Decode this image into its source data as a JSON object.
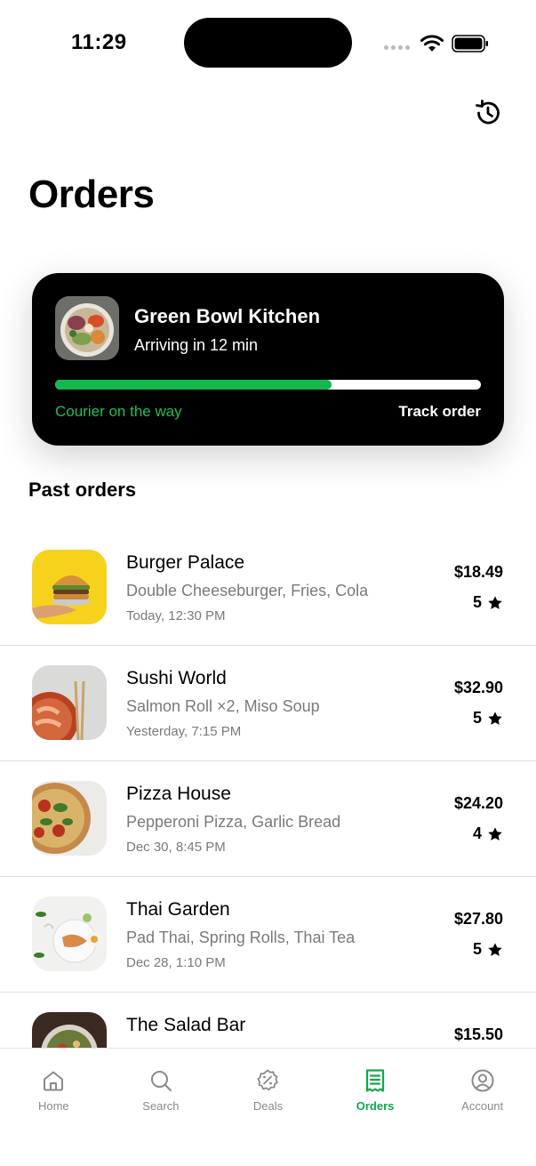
{
  "status_bar": {
    "time": "11:29"
  },
  "header": {
    "title": "Orders",
    "history_icon": "history-icon"
  },
  "active_order": {
    "restaurant": "Green Bowl Kitchen",
    "eta": "Arriving in 12 min",
    "progress": 0.65,
    "status": "Courier on the way",
    "action": "Track order",
    "accent": "#15b84e"
  },
  "past_orders": {
    "title": "Past orders",
    "items": [
      {
        "name": "Burger Palace",
        "items": "Double Cheeseburger, Fries, Cola",
        "date": "Today, 12:30 PM",
        "price": "$18.49",
        "rating": "5"
      },
      {
        "name": "Sushi World",
        "items": "Salmon Roll ×2, Miso Soup",
        "date": "Yesterday, 7:15 PM",
        "price": "$32.90",
        "rating": "5"
      },
      {
        "name": "Pizza House",
        "items": "Pepperoni Pizza, Garlic Bread",
        "date": "Dec 30, 8:45 PM",
        "price": "$24.20",
        "rating": "4"
      },
      {
        "name": "Thai Garden",
        "items": "Pad Thai, Spring Rolls, Thai Tea",
        "date": "Dec 28, 1:10 PM",
        "price": "$27.80",
        "rating": "5"
      },
      {
        "name": "The Salad Bar",
        "items": "",
        "date": "",
        "price": "$15.50",
        "rating": ""
      }
    ]
  },
  "tab_bar": {
    "active_color": "#10a84a",
    "tabs": [
      {
        "label": "Home",
        "icon": "home-icon"
      },
      {
        "label": "Search",
        "icon": "search-icon"
      },
      {
        "label": "Deals",
        "icon": "discount-icon"
      },
      {
        "label": "Orders",
        "icon": "receipt-icon"
      },
      {
        "label": "Account",
        "icon": "account-icon"
      }
    ]
  }
}
